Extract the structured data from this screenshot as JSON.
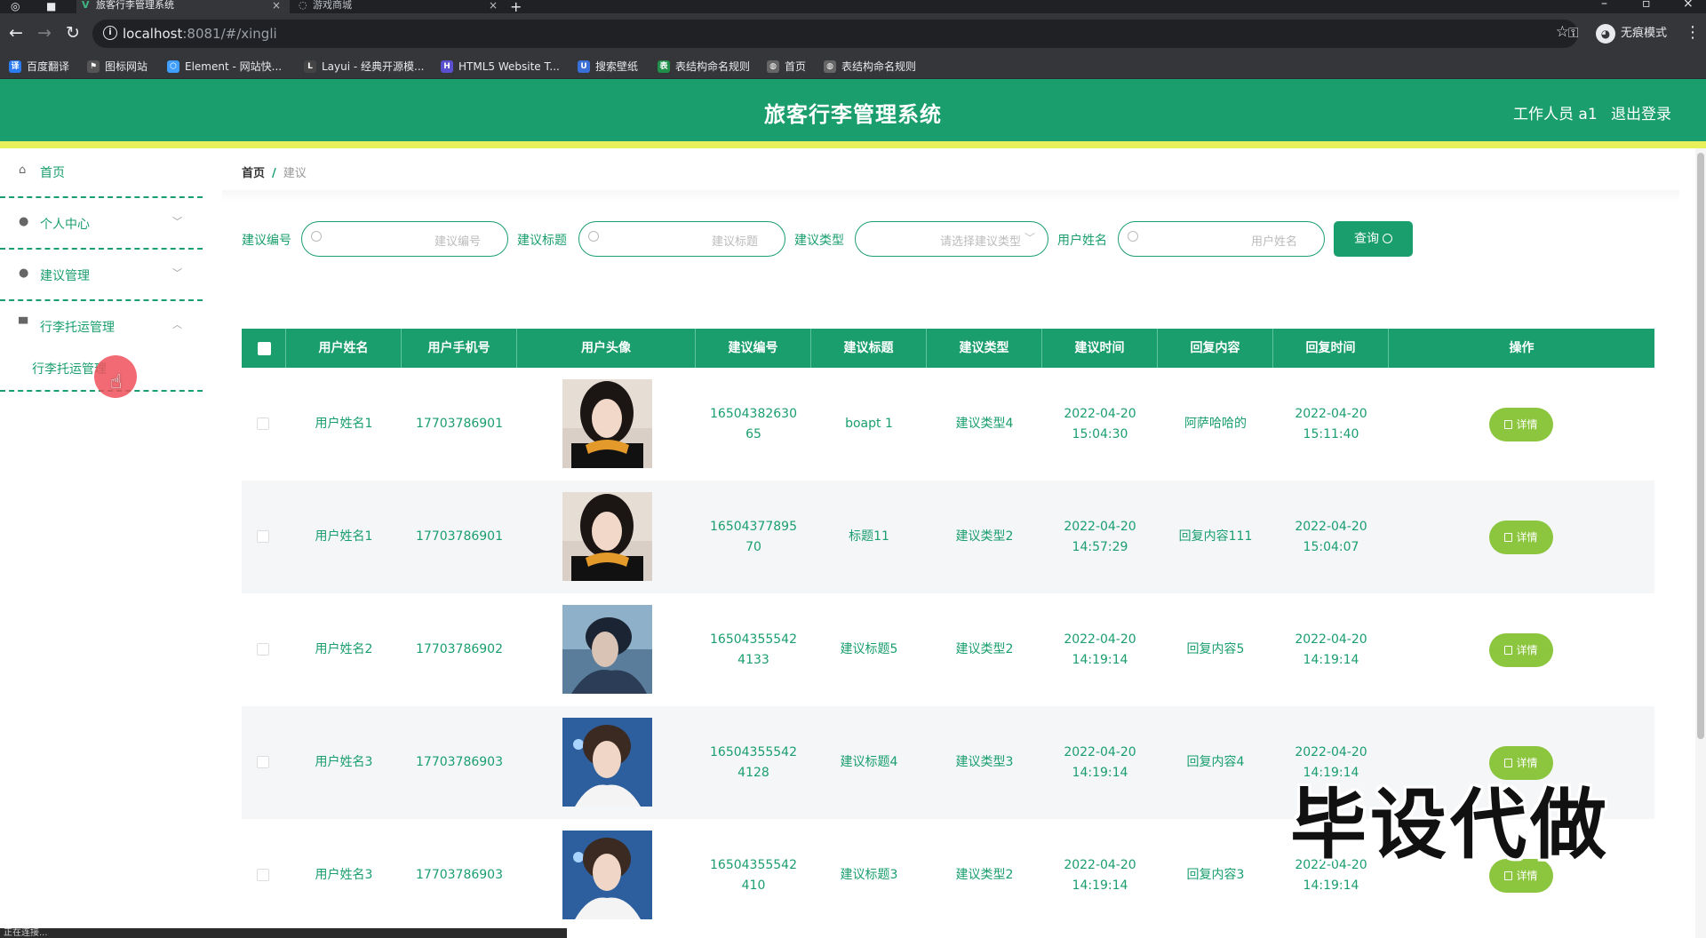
{
  "browser": {
    "tabs": [
      {
        "title": "旅客行李管理系统",
        "active": true
      },
      {
        "title": "游戏商城",
        "active": false
      }
    ],
    "url_host": "localhost",
    "url_rest": ":8081/#/xingli",
    "incognito_label": "无痕模式",
    "bookmarks": [
      {
        "label": "百度翻译",
        "icon": "baidu-translate-icon",
        "color": "#2b7bf3"
      },
      {
        "label": "图标网站",
        "icon": "flag-icon",
        "color": "#555555"
      },
      {
        "label": "Element - 网站快...",
        "icon": "element-icon",
        "color": "#409eff"
      },
      {
        "label": "Layui - 经典开源模...",
        "icon": "layui-icon",
        "color": "#444444"
      },
      {
        "label": "HTML5 Website T...",
        "icon": "html5-icon",
        "color": "#5a4fcf"
      },
      {
        "label": "搜索壁纸",
        "icon": "wallpaper-icon",
        "color": "#3a6fd8"
      },
      {
        "label": "表结构命名规则",
        "icon": "sheet-icon",
        "color": "#1f8f4a"
      },
      {
        "label": "首页",
        "icon": "globe-icon",
        "color": "#666666"
      },
      {
        "label": "表结构命名规则",
        "icon": "globe-icon",
        "color": "#666666"
      }
    ]
  },
  "app": {
    "title": "旅客行李管理系统",
    "user": "工作人员 a1",
    "logout": "退出登录",
    "colors": {
      "primary": "#1a9e6e",
      "accent_bar": "#e7f05a",
      "detail_button": "#8cc63f"
    }
  },
  "sidebar": {
    "items": [
      {
        "label": "首页",
        "icon": "home-icon",
        "chevron": ""
      },
      {
        "label": "个人中心",
        "icon": "user-icon",
        "chevron": "﹀"
      },
      {
        "label": "建议管理",
        "icon": "user-icon",
        "chevron": "﹀"
      },
      {
        "label": "行李托运管理",
        "icon": "monitor-icon",
        "chevron": "︿"
      }
    ],
    "subitem": "行李托运管理"
  },
  "breadcrumb": {
    "home": "首页",
    "separator": "/",
    "current": "建议"
  },
  "search": {
    "fields": [
      {
        "label": "建议编号",
        "placeholder": "建议编号",
        "type": "text"
      },
      {
        "label": "建议标题",
        "placeholder": "建议标题",
        "type": "text"
      },
      {
        "label": "建议类型",
        "placeholder": "请选择建议类型",
        "type": "select"
      },
      {
        "label": "用户姓名",
        "placeholder": "用户姓名",
        "type": "text"
      }
    ],
    "button": "查询"
  },
  "table": {
    "headers": [
      "用户姓名",
      "用户手机号",
      "用户头像",
      "建议编号",
      "建议标题",
      "建议类型",
      "建议时间",
      "回复内容",
      "回复时间",
      "操作"
    ],
    "detail_label": "详情",
    "rows": [
      {
        "name": "用户姓名1",
        "phone": "17703786901",
        "avatar": "female-avatar",
        "code": "1650438263065",
        "title": "boapt 1",
        "type": "建议类型4",
        "time": "2022-04-20 15:04:30",
        "reply": "阿萨哈哈的",
        "reply_time": "2022-04-20 15:11:40"
      },
      {
        "name": "用户姓名1",
        "phone": "17703786901",
        "avatar": "female-avatar",
        "code": "1650437789570",
        "title": "标题11",
        "type": "建议类型2",
        "time": "2022-04-20 14:57:29",
        "reply": "回复内容111",
        "reply_time": "2022-04-20 15:04:07"
      },
      {
        "name": "用户姓名2",
        "phone": "17703786902",
        "avatar": "male-avatar-blue",
        "code": "165043555424133",
        "title": "建议标题5",
        "type": "建议类型2",
        "time": "2022-04-20 14:19:14",
        "reply": "回复内容5",
        "reply_time": "2022-04-20 14:19:14"
      },
      {
        "name": "用户姓名3",
        "phone": "17703786903",
        "avatar": "male-avatar-light",
        "code": "165043555424128",
        "title": "建议标题4",
        "type": "建议类型3",
        "time": "2022-04-20 14:19:14",
        "reply": "回复内容4",
        "reply_time": "2022-04-20 14:19:14"
      },
      {
        "name": "用户姓名3",
        "phone": "17703786903",
        "avatar": "male-avatar-light",
        "code": "16504355542410",
        "title": "建议标题3",
        "type": "建议类型2",
        "time": "2022-04-20 14:19:14",
        "reply": "回复内容3",
        "reply_time": "2022-04-20 14:19:14"
      }
    ]
  },
  "watermark": "毕设代做",
  "status": "正在连接..."
}
